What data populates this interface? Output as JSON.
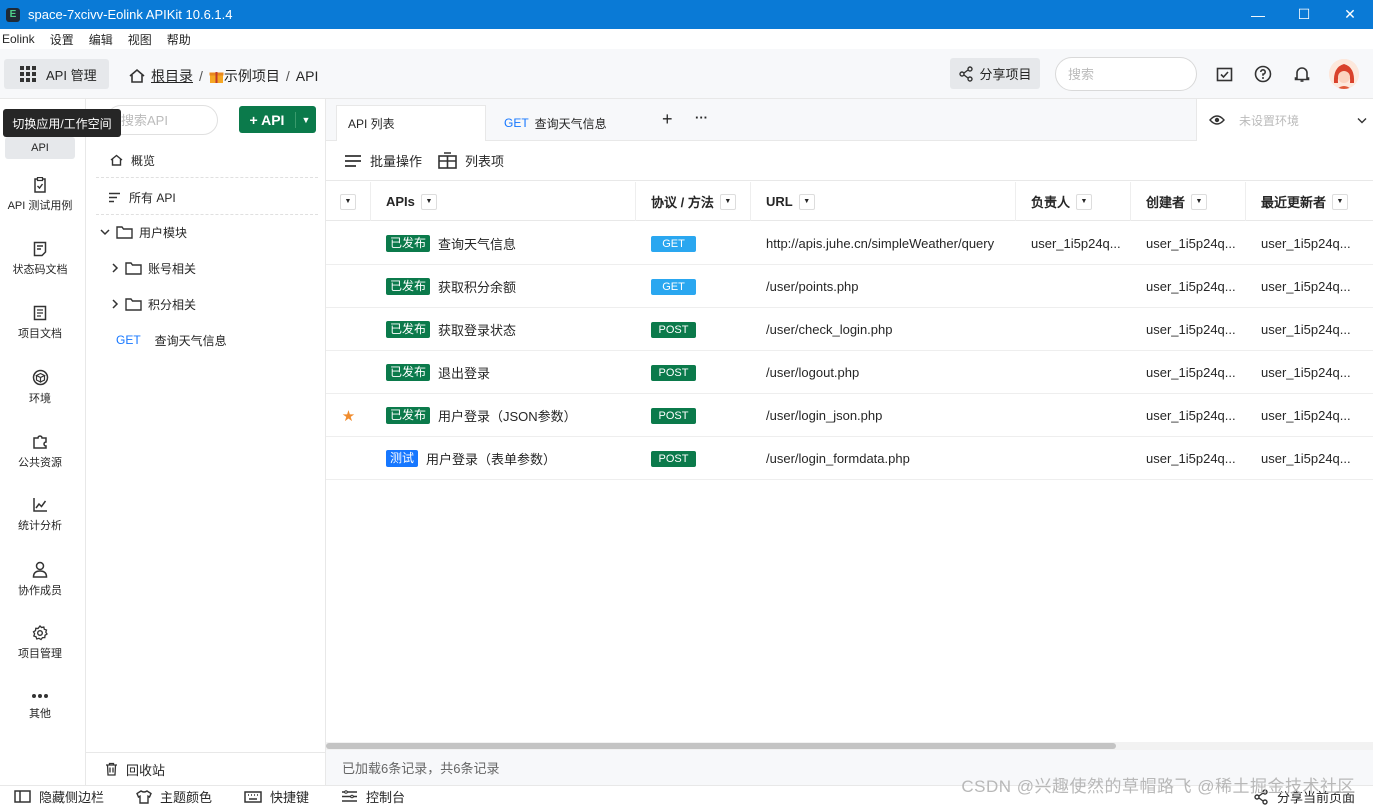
{
  "window": {
    "title": "space-7xcivv-Eolink APIKit 10.6.1.4",
    "logo_text": "E"
  },
  "menubar": [
    "Eolink",
    "设置",
    "编辑",
    "视图",
    "帮助"
  ],
  "toolbar": {
    "app_button": "API 管理",
    "breadcrumb": {
      "root": "根目录",
      "project": "示例项目",
      "current": "API"
    },
    "share_button": "分享项目",
    "search_placeholder": "搜索"
  },
  "tooltip": "切换应用/工作空间",
  "rail": {
    "items": [
      "API",
      "API 测试用例",
      "状态码文档",
      "项目文档",
      "环境",
      "公共资源",
      "统计分析",
      "协作成员",
      "项目管理",
      "其他"
    ]
  },
  "sidebar": {
    "search_placeholder": "搜索API",
    "add_button": "+ API",
    "overview": "概览",
    "all_api": "所有 API",
    "group": "用户模块",
    "subgroups": [
      "账号相关",
      "积分相关"
    ],
    "api_item": {
      "method": "GET",
      "name": "查询天气信息"
    },
    "recycle": "回收站"
  },
  "tabs": {
    "tab1": "API 列表",
    "tab2_method": "GET",
    "tab2_name": "查询天气信息",
    "add": "+",
    "more": "···",
    "env_placeholder": "未设置环境"
  },
  "actions": {
    "batch": "批量操作",
    "columns": "列表项"
  },
  "table": {
    "headers": {
      "apis": "APIs",
      "protocol": "协议 / 方法",
      "url": "URL",
      "owner": "负责人",
      "creator": "创建者",
      "updater": "最近更新者"
    },
    "rows": [
      {
        "star": "",
        "status": "已发布",
        "status_type": "pub",
        "name": "查询天气信息",
        "method": "GET",
        "url": "http://apis.juhe.cn/simpleWeather/query",
        "owner": "user_1i5p24q...",
        "creator": "user_1i5p24q...",
        "updater": "user_1i5p24q..."
      },
      {
        "star": "",
        "status": "已发布",
        "status_type": "pub",
        "name": "获取积分余额",
        "method": "GET",
        "url": "/user/points.php",
        "owner": "",
        "creator": "user_1i5p24q...",
        "updater": "user_1i5p24q..."
      },
      {
        "star": "",
        "status": "已发布",
        "status_type": "pub",
        "name": "获取登录状态",
        "method": "POST",
        "url": "/user/check_login.php",
        "owner": "",
        "creator": "user_1i5p24q...",
        "updater": "user_1i5p24q..."
      },
      {
        "star": "",
        "status": "已发布",
        "status_type": "pub",
        "name": "退出登录",
        "method": "POST",
        "url": "/user/logout.php",
        "owner": "",
        "creator": "user_1i5p24q...",
        "updater": "user_1i5p24q..."
      },
      {
        "star": "★",
        "status": "已发布",
        "status_type": "pub",
        "name": "用户登录（JSON参数）",
        "method": "POST",
        "url": "/user/login_json.php",
        "owner": "",
        "creator": "user_1i5p24q...",
        "updater": "user_1i5p24q..."
      },
      {
        "star": "",
        "status": "测试",
        "status_type": "test",
        "name": "用户登录（表单参数）",
        "method": "POST",
        "url": "/user/login_formdata.php",
        "owner": "",
        "creator": "user_1i5p24q...",
        "updater": "user_1i5p24q..."
      }
    ]
  },
  "footer": "已加载6条记录，共6条记录",
  "statusbar": {
    "hide_sidebar": "隐藏侧边栏",
    "theme": "主题颜色",
    "shortcuts": "快捷键",
    "console": "控制台",
    "share_page": "分享当前页面"
  },
  "watermark": "CSDN @兴趣使然的草帽路飞 @稀土掘金技术社区",
  "colors": {
    "titlebar": "#0a7ad6",
    "primary_green": "#0b7a4b",
    "get_blue": "#2aa7f0",
    "test_blue": "#1677ff",
    "star": "#f08c2e"
  }
}
